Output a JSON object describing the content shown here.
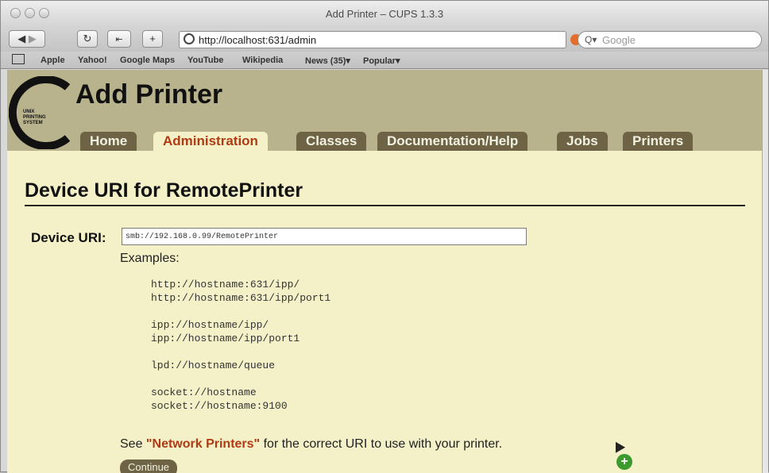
{
  "window": {
    "title": "Add Printer – CUPS 1.3.3"
  },
  "toolbar": {
    "url": "http://localhost:631/admin",
    "search_placeholder": "Google"
  },
  "bookmarks": [
    "Apple",
    "Yahoo!",
    "Google Maps",
    "YouTube",
    "Wikipedia",
    "News (35)▾",
    "Popular▾"
  ],
  "header": {
    "logo_text": "UNIX\nPRINTING\nSYSTEM",
    "title": "Add Printer",
    "tabs": [
      {
        "label": "Home",
        "active": false
      },
      {
        "label": "Administration",
        "active": true
      },
      {
        "label": "Classes",
        "active": false
      },
      {
        "label": "Documentation/Help",
        "active": false
      },
      {
        "label": "Jobs",
        "active": false
      },
      {
        "label": "Printers",
        "active": false
      }
    ]
  },
  "content": {
    "section_title": "Device URI for RemotePrinter",
    "device_label": "Device URI:",
    "device_value": "smb://192.168.0.99/RemotePrinter",
    "examples_label": "Examples:",
    "examples": [
      [
        "http://hostname:631/ipp/",
        "http://hostname:631/ipp/port1"
      ],
      [
        "ipp://hostname/ipp/",
        "ipp://hostname/ipp/port1"
      ],
      [
        "lpd://hostname/queue"
      ],
      [
        "socket://hostname",
        "socket://hostname:9100"
      ]
    ],
    "note_prefix": "See",
    "note_link": "\"Network Printers\"",
    "note_suffix": "for the correct URI to use with your printer.",
    "continue_label": "Continue"
  },
  "colors": {
    "page_bg": "#f4f1c9",
    "header_bg": "#b8b38c",
    "tab_bg": "#6e6344",
    "accent": "#b03b13"
  }
}
